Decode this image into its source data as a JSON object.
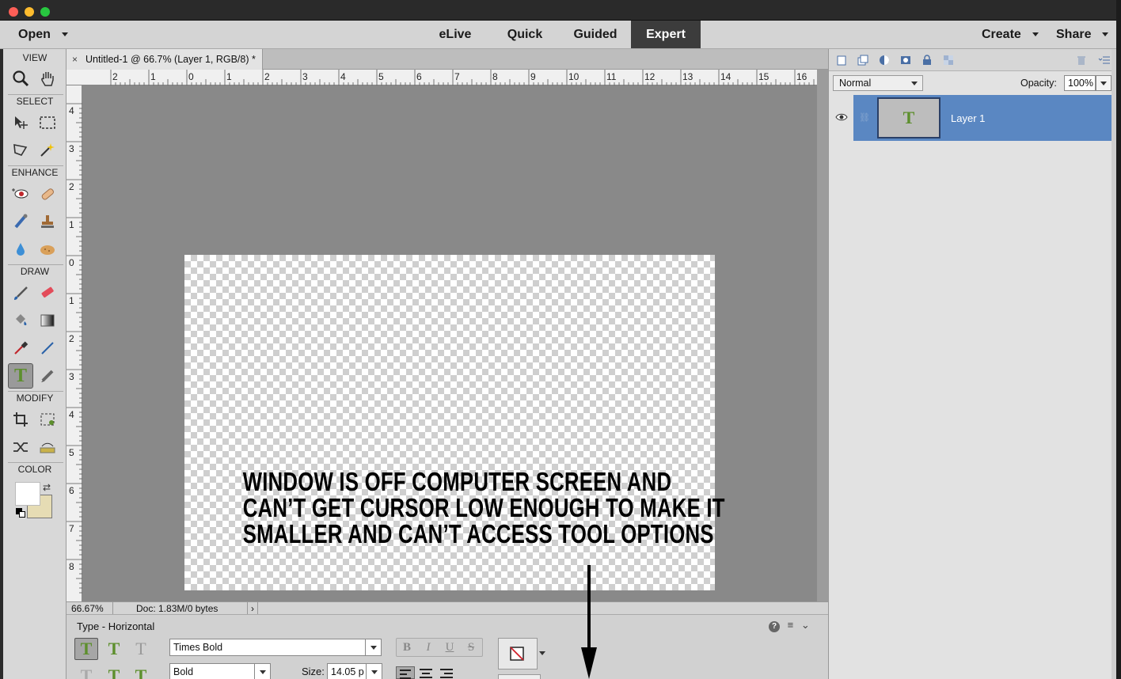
{
  "menubar": {
    "open_label": "Open",
    "create_label": "Create",
    "share_label": "Share",
    "modes": [
      "eLive",
      "Quick",
      "Guided",
      "Expert"
    ],
    "active_mode": "Expert"
  },
  "toolbox": {
    "sections": {
      "view": "VIEW",
      "select": "SELECT",
      "enhance": "ENHANCE",
      "draw": "DRAW",
      "modify": "MODIFY",
      "color": "COLOR"
    },
    "foreground_color": "#ffffff",
    "background_color": "#e6dcb4"
  },
  "document": {
    "tab_title": "Untitled-1 @ 66.7% (Layer 1, RGB/8) *",
    "ruler_top_labels": [
      "2",
      "1",
      "0",
      "1",
      "2",
      "3",
      "4",
      "5",
      "6",
      "7",
      "8",
      "9",
      "10",
      "11",
      "12",
      "13",
      "14",
      "15",
      "16"
    ],
    "ruler_left_labels": [
      "4",
      "3",
      "2",
      "1",
      "0",
      "1",
      "2",
      "3",
      "4",
      "5",
      "6",
      "7",
      "8"
    ],
    "canvas_text_lines": [
      "WINDOW IS OFF COMPUTER SCREEN AND",
      "CAN’T GET CURSOR LOW ENOUGH TO MAKE IT",
      "SMALLER AND CAN’T ACCESS TOOL OPTIONS"
    ]
  },
  "status": {
    "zoom": "66.67%",
    "doc_info": "Doc: 1.83M/0 bytes"
  },
  "tool_options": {
    "title": "Type - Horizontal",
    "font_family": "Times Bold",
    "font_style": "Bold",
    "size_label": "Size:",
    "size_value": "14.05 p",
    "format_buttons": [
      "B",
      "I",
      "U",
      "S"
    ]
  },
  "layers_panel": {
    "blend_mode": "Normal",
    "opacity_label": "Opacity:",
    "opacity_value": "100%",
    "layer_name": "Layer 1",
    "layer_thumb_glyph": "T"
  },
  "colors": {
    "active_mode_bg": "#3c3c3c",
    "layer_selected_bg": "#5a87c2",
    "type_tool_green": "#5d8f2d"
  }
}
